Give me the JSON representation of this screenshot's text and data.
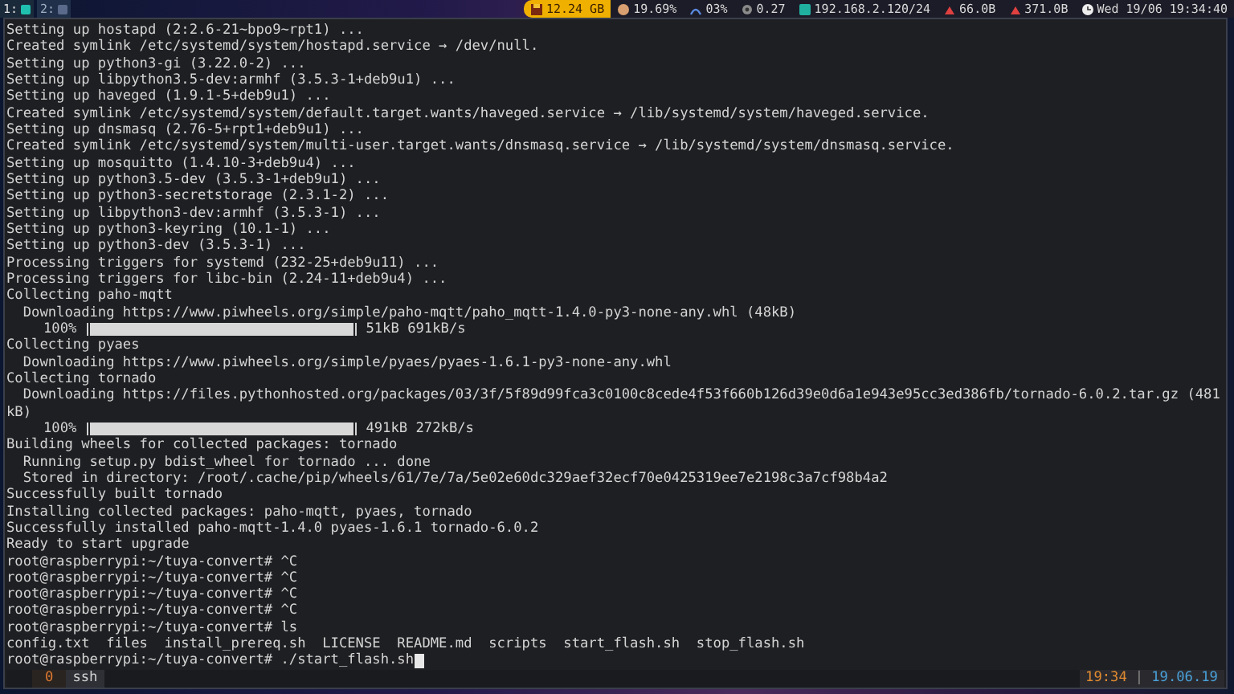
{
  "top_bar": {
    "workspaces": [
      {
        "label": "1:",
        "selected": true
      },
      {
        "label": "2:",
        "selected": false
      }
    ],
    "status": [
      {
        "kind": "disk",
        "text": "12.24 GB"
      },
      {
        "kind": "cpu",
        "text": "19.69%"
      },
      {
        "kind": "wifi",
        "text": "03%"
      },
      {
        "kind": "load",
        "text": "0.27"
      },
      {
        "kind": "net",
        "text": "192.168.2.120/24"
      },
      {
        "kind": "down",
        "text": "66.0B"
      },
      {
        "kind": "up",
        "text": "371.0B"
      },
      {
        "kind": "clock",
        "text": "Wed 19/06 19:34:40"
      }
    ]
  },
  "terminal": {
    "lines": [
      {
        "kind": "text",
        "text": "Setting up hostapd (2:2.6-21~bpo9~rpt1) ..."
      },
      {
        "kind": "text",
        "text": "Created symlink /etc/systemd/system/hostapd.service → /dev/null."
      },
      {
        "kind": "text",
        "text": "Setting up python3-gi (3.22.0-2) ..."
      },
      {
        "kind": "text",
        "text": "Setting up libpython3.5-dev:armhf (3.5.3-1+deb9u1) ..."
      },
      {
        "kind": "text",
        "text": "Setting up haveged (1.9.1-5+deb9u1) ..."
      },
      {
        "kind": "text",
        "text": "Created symlink /etc/systemd/system/default.target.wants/haveged.service → /lib/systemd/system/haveged.service."
      },
      {
        "kind": "text",
        "text": "Setting up dnsmasq (2.76-5+rpt1+deb9u1) ..."
      },
      {
        "kind": "text",
        "text": "Created symlink /etc/systemd/system/multi-user.target.wants/dnsmasq.service → /lib/systemd/system/dnsmasq.service."
      },
      {
        "kind": "text",
        "text": "Setting up mosquitto (1.4.10-3+deb9u4) ..."
      },
      {
        "kind": "text",
        "text": "Setting up python3.5-dev (3.5.3-1+deb9u1) ..."
      },
      {
        "kind": "text",
        "text": "Setting up python3-secretstorage (2.3.1-2) ..."
      },
      {
        "kind": "text",
        "text": "Setting up libpython3-dev:armhf (3.5.3-1) ..."
      },
      {
        "kind": "text",
        "text": "Setting up python3-keyring (10.1-1) ..."
      },
      {
        "kind": "text",
        "text": "Setting up python3-dev (3.5.3-1) ..."
      },
      {
        "kind": "text",
        "text": "Processing triggers for systemd (232-25+deb9u11) ..."
      },
      {
        "kind": "text",
        "text": "Processing triggers for libc-bin (2.24-11+deb9u4) ..."
      },
      {
        "kind": "text",
        "text": "Collecting paho-mqtt"
      },
      {
        "kind": "text",
        "text": "  Downloading https://www.piwheels.org/simple/paho-mqtt/paho_mqtt-1.4.0-py3-none-any.whl (48kB)"
      },
      {
        "kind": "progress",
        "percent": "100%",
        "level": 1,
        "reading": "51kB 691kB/s"
      },
      {
        "kind": "text",
        "text": "Collecting pyaes"
      },
      {
        "kind": "text",
        "text": "  Downloading https://www.piwheels.org/simple/pyaes/pyaes-1.6.1-py3-none-any.whl"
      },
      {
        "kind": "text",
        "text": "Collecting tornado"
      },
      {
        "kind": "text",
        "text": "  Downloading https://files.pythonhosted.org/packages/03/3f/5f89d99fca3c0100c8cede4f53f660b126d39e0d6a1e943e95cc3ed386fb/tornado-6.0.2.tar.gz (481"
      },
      {
        "kind": "text",
        "text": "kB)"
      },
      {
        "kind": "progress",
        "percent": "100%",
        "level": 1,
        "reading": "491kB 272kB/s"
      },
      {
        "kind": "text",
        "text": "Building wheels for collected packages: tornado"
      },
      {
        "kind": "text",
        "text": "  Running setup.py bdist_wheel for tornado ... done"
      },
      {
        "kind": "text",
        "text": "  Stored in directory: /root/.cache/pip/wheels/61/7e/7a/5e02e60dc329aef32ecf70e0425319ee7e2198c3a7cf98b4a2"
      },
      {
        "kind": "text",
        "text": "Successfully built tornado"
      },
      {
        "kind": "text",
        "text": "Installing collected packages: paho-mqtt, pyaes, tornado"
      },
      {
        "kind": "text",
        "text": "Successfully installed paho-mqtt-1.4.0 pyaes-1.6.1 tornado-6.0.2"
      },
      {
        "kind": "text",
        "text": "Ready to start upgrade"
      },
      {
        "kind": "text",
        "text": "root@raspberrypi:~/tuya-convert# ^C"
      },
      {
        "kind": "text",
        "text": "root@raspberrypi:~/tuya-convert# ^C"
      },
      {
        "kind": "text",
        "text": "root@raspberrypi:~/tuya-convert# ^C"
      },
      {
        "kind": "text",
        "text": "root@raspberrypi:~/tuya-convert# ^C"
      },
      {
        "kind": "text",
        "text": "root@raspberrypi:~/tuya-convert# ls"
      },
      {
        "kind": "text",
        "text": "config.txt  files  install_prereq.sh  LICENSE  README.md  scripts  start_flash.sh  stop_flash.sh"
      },
      {
        "kind": "text",
        "text": "root@raspberrypi:~/tuya-convert# ./start_flash.sh",
        "cursor": true
      }
    ]
  },
  "tmux_bar": {
    "windows": [
      {
        "index": "0",
        "name": "ssh",
        "selected": true
      }
    ],
    "time": "19:34",
    "separator": "|",
    "date": "19.06.19"
  }
}
